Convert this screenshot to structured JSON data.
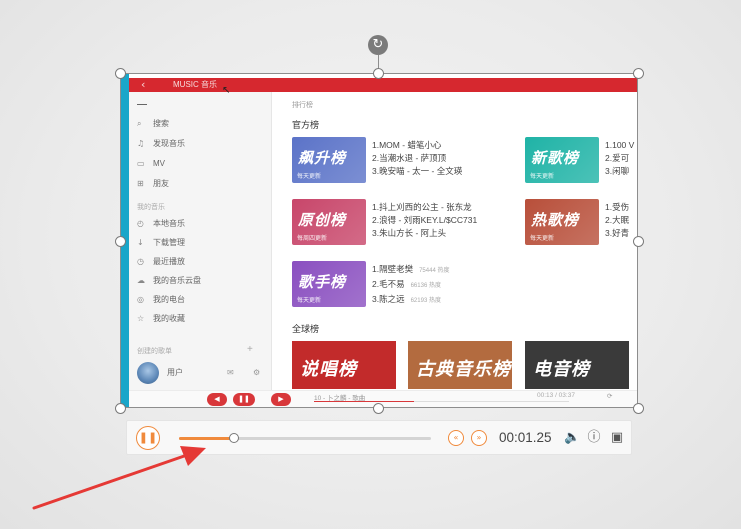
{
  "rotate_glyph": "↻",
  "app": {
    "title_back": "‹",
    "title": "MUSIC 音乐",
    "cursor": "↖",
    "sidebar": {
      "items_top": [
        {
          "icon": "⌕",
          "label": "搜索"
        },
        {
          "icon": "♫",
          "label": "发现音乐"
        },
        {
          "icon": "▭",
          "label": "MV"
        },
        {
          "icon": "⊞",
          "label": "朋友"
        }
      ],
      "my_music_header": "我的音乐",
      "items_mine": [
        {
          "icon": "◴",
          "label": "本地音乐"
        },
        {
          "icon": "↓",
          "label": "下载管理"
        },
        {
          "icon": "◷",
          "label": "最近播放"
        },
        {
          "icon": "☁",
          "label": "我的音乐云盘"
        },
        {
          "icon": "◎",
          "label": "我的电台"
        },
        {
          "icon": "☆",
          "label": "我的收藏"
        }
      ],
      "playlist_header": "创建的歌单",
      "playlist_add": "+",
      "user_name": "用户",
      "user_icons": [
        "✉",
        "⚙"
      ]
    },
    "main": {
      "crumb": "排行榜",
      "official_header": "官方榜",
      "global_header": "全球榜",
      "boards": [
        {
          "title": "飙升榜",
          "sub": "每天更新",
          "color": "#5b73c8",
          "lines": [
            "1.MOM - 蜡笔小心",
            "2.当潮水退 - 萨顶顶",
            "3.晚安喵 - 太一 - 全文瑛"
          ]
        },
        {
          "title": "新歌榜",
          "sub": "每天更新",
          "color": "#1fb3a6",
          "lines": [
            "1.100 V",
            "2.爱可",
            "3.闲聊"
          ]
        },
        {
          "title": "原创榜",
          "sub": "每周四更新",
          "color": "#c8466a",
          "lines": [
            "1.抖上刈西的公主 - 张东龙",
            "2.浪得 - 刘雨KEY.L/$CC731",
            "3.朱山方长 - 阿上头"
          ]
        },
        {
          "title": "热歌榜",
          "sub": "每天更新",
          "color": "#b84f3a",
          "lines": [
            "1.受伤",
            "2.大眠",
            "3.好青"
          ]
        },
        {
          "title": "歌手榜",
          "sub": "每天更新",
          "color": "#8a4fc0",
          "lines": [
            "1.隔壁老樊",
            "2.毛不易",
            "3.陈之远"
          ],
          "dim": [
            "75444 热度",
            "66136 热度",
            "62193 热度"
          ]
        }
      ],
      "big_cards": [
        {
          "title": "说唱榜",
          "color": "#c22b2b"
        },
        {
          "title": "古典音乐榜",
          "color": "#b36b3f"
        },
        {
          "title": "电音榜",
          "color": "#3a3a3a"
        }
      ]
    },
    "bottom": {
      "prev": "◀",
      "pause": "❚❚",
      "next": "▶",
      "song": "10 - 卜之麟 - 歌曲",
      "time": "00:13 / 03:37",
      "right_icon": "⟳"
    }
  },
  "player": {
    "play_pause": "❚❚",
    "progress": 0.22,
    "rewind": "«",
    "forward": "»",
    "time": "00:01.25",
    "volume_icon": "🔈",
    "info_icon": "ⓘ",
    "image_icon": "▣",
    "accent": "#f08a3c"
  },
  "annotation_arrow_color": "#e53935"
}
